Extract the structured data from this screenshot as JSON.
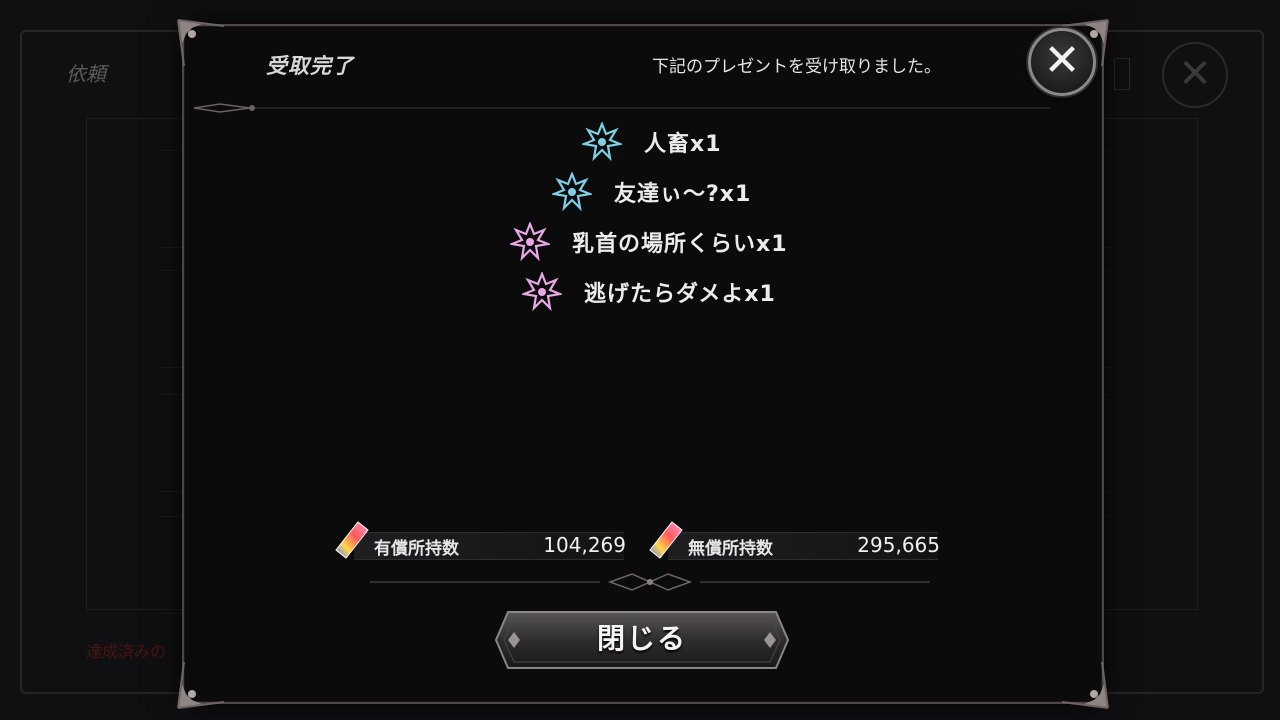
{
  "background": {
    "screen_title": "依頼",
    "footer_text": "達成済みの"
  },
  "modal": {
    "title": "受取完了",
    "message": "下記のプレゼントを受け取りました。",
    "close_icon": "close-x-icon",
    "rewards": [
      {
        "name": "人畜x1",
        "icon": "emblem-icon",
        "color": "#7fd0e6"
      },
      {
        "name": "友達ぃ～?x1",
        "icon": "emblem-icon",
        "color": "#7fd0e6"
      },
      {
        "name": "乳首の場所くらいx1",
        "icon": "emblem-icon",
        "color": "#e9a8e6"
      },
      {
        "name": "逃げたらダメよx1",
        "icon": "emblem-icon",
        "color": "#e9a8e6"
      }
    ],
    "currencies": [
      {
        "label": "有償所持数",
        "value": "104,269",
        "icon": "gem-icon"
      },
      {
        "label": "無償所持数",
        "value": "295,665",
        "icon": "gem-icon"
      }
    ],
    "close_button_label": "閉じる"
  },
  "colors": {
    "frame": "#4e4646",
    "reward_blue": "#7fd0e6",
    "reward_pink": "#e9a8e6"
  }
}
